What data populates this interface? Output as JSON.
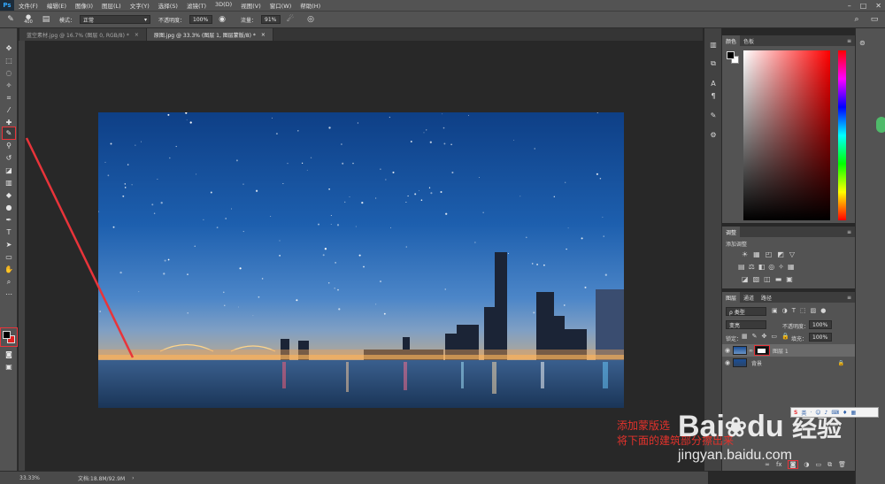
{
  "app": {
    "logo": "Ps"
  },
  "menu": [
    "文件(F)",
    "编辑(E)",
    "图像(I)",
    "图层(L)",
    "文字(Y)",
    "选择(S)",
    "滤镜(T)",
    "3D(D)",
    "视图(V)",
    "窗口(W)",
    "帮助(H)"
  ],
  "window_controls": {
    "minimize": "–",
    "maximize": "□",
    "close": "✕"
  },
  "options": {
    "brush_size": "400",
    "mode_label": "模式：",
    "mode_value": "正常",
    "opacity_label": "不透明度：",
    "opacity_value": "100%",
    "flow_label": "流量：",
    "flow_value": "91%"
  },
  "tabs": [
    {
      "label": "蓝空素材.jpg @ 16.7% (图层 0, RGB/8) *",
      "close": "×"
    },
    {
      "label": "原图.jpg @ 33.3% (图层 1, 图层蒙版/8) *",
      "close": "×"
    }
  ],
  "status": {
    "zoom": "33.33%",
    "doc": "文档:18.8M/92.9M",
    "arrow": "›"
  },
  "color_panel": {
    "tabs": [
      "颜色",
      "色板"
    ]
  },
  "adjust_panel": {
    "tab": "调整",
    "add_label": "添加调整"
  },
  "layers_panel": {
    "tabs": [
      "图层",
      "通道",
      "路径"
    ],
    "filter_kind": "ρ 类型",
    "blend_mode": "变亮",
    "opacity_label": "不透明度：",
    "opacity_value": "100%",
    "lock_label": "锁定：",
    "fill_label": "填充：",
    "fill_value": "100%",
    "layers": [
      {
        "name": "图层 1"
      },
      {
        "name": "背景"
      }
    ]
  },
  "annotation": {
    "line1": "添加蒙版选",
    "line2": "将下面的建筑部分擦出来"
  },
  "watermark": {
    "brand_a": "Bai",
    "brand_b": "du",
    "brand_cn": "经验",
    "url": "jingyan.baidu.com"
  },
  "ime_badge": "英",
  "colors": {
    "accent_red": "#e8343a",
    "bg_dark": "#282828",
    "panel": "#535353"
  }
}
